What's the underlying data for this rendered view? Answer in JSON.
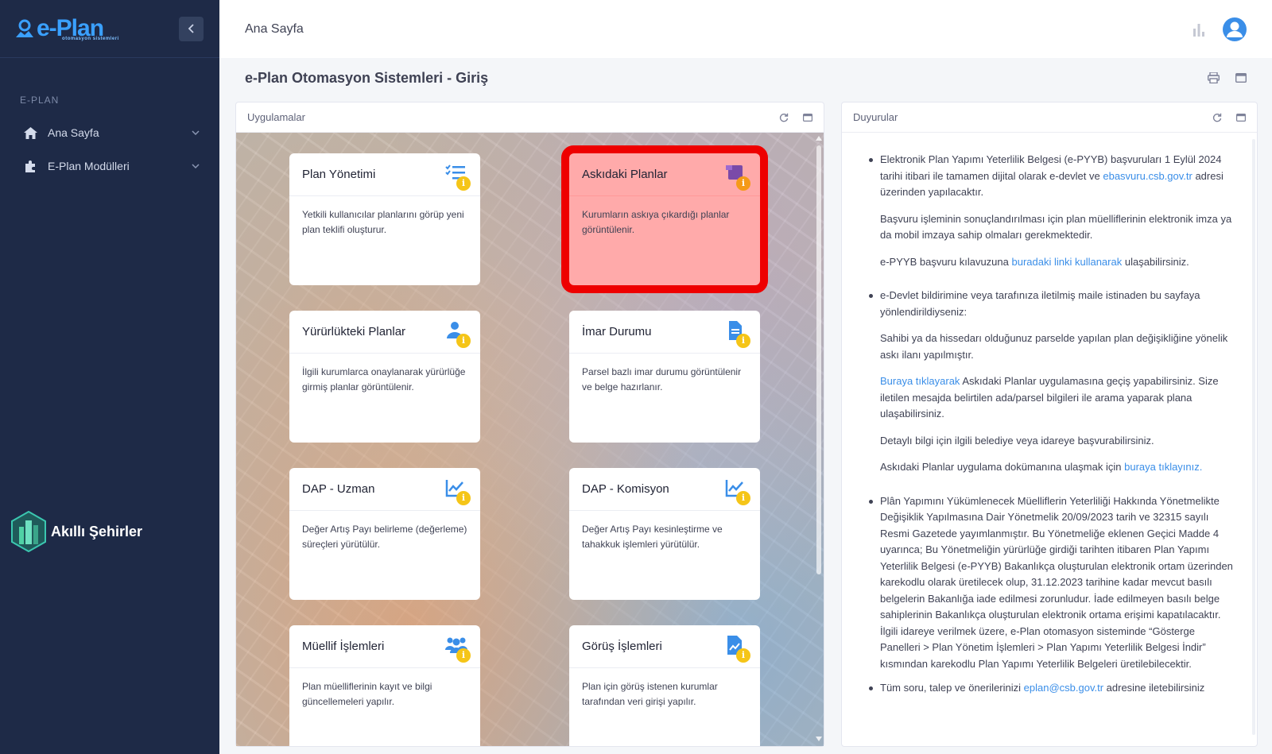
{
  "sidebar": {
    "logo_text": "e-Plan",
    "logo_subtext": "otomasyon sistemleri",
    "section_label": "E-PLAN",
    "items": [
      {
        "label": "Ana Sayfa"
      },
      {
        "label": "E-Plan Modülleri"
      }
    ],
    "brand_text": "Akıllı Şehirler"
  },
  "header": {
    "title": "Ana Sayfa"
  },
  "page": {
    "title": "e-Plan Otomasyon Sistemleri - Giriş"
  },
  "apps_panel": {
    "title": "Uygulamalar",
    "tiles": [
      {
        "title": "Plan Yönetimi",
        "desc": "Yetkili kullanıcılar planlarını görüp yeni plan teklifi oluşturur.",
        "icon": "list-check-icon",
        "info": "i"
      },
      {
        "title": "Askıdaki Planlar",
        "desc": "Kurumların askıya çıkardığı planlar görüntülenir.",
        "icon": "bookmark-icon",
        "info": "i",
        "highlighted": true
      },
      {
        "title": "Yürürlükteki Planlar",
        "desc": "İlgili kurumlarca onaylanarak yürürlüğe girmiş planlar görüntülenir.",
        "icon": "user-icon",
        "info": "i"
      },
      {
        "title": "İmar Durumu",
        "desc": "Parsel bazlı imar durumu görüntülenir ve belge hazırlanır.",
        "icon": "document-icon",
        "info": "i"
      },
      {
        "title": "DAP - Uzman",
        "desc": "Değer Artış Payı belirleme (değerleme) süreçleri yürütülür.",
        "icon": "chart-line-icon",
        "info": "i"
      },
      {
        "title": "DAP - Komisyon",
        "desc": "Değer Artış Payı kesinleştirme ve tahakkuk işlemleri yürütülür.",
        "icon": "chart-line-icon",
        "info": "i"
      },
      {
        "title": "Müellif İşlemleri",
        "desc": "Plan müelliflerinin kayıt ve bilgi güncellemeleri yapılır.",
        "icon": "users-icon",
        "info": "i"
      },
      {
        "title": "Görüş İşlemleri",
        "desc": "Plan için görüş istenen kurumlar tarafından veri girişi yapılır.",
        "icon": "file-chart-icon",
        "info": "i"
      }
    ]
  },
  "ann_panel": {
    "title": "Duyurular",
    "a1_p1_pre": "Elektronik Plan Yapımı Yeterlilik Belgesi (e-PYYB) başvuruları 1 Eylül 2024 tarihi itibari ile tamamen dijital olarak e-devlet ve ",
    "a1_p1_link": "ebasvuru.csb.gov.tr",
    "a1_p1_post": " adresi üzerinden yapılacaktır.",
    "a1_p2": "Başvuru işleminin sonuçlandırılması için plan müelliflerinin elektronik imza ya da mobil imzaya sahip olmaları gerekmektedir.",
    "a1_p3_pre": "e-PYYB başvuru kılavuzuna ",
    "a1_p3_link": "buradaki linki kullanarak",
    "a1_p3_post": " ulaşabilirsiniz.",
    "a2_p1": "e-Devlet bildirimine veya tarafınıza iletilmiş maile istinaden bu sayfaya yönlendirildiyseniz:",
    "a2_p2": "Sahibi ya da hissedarı olduğunuz parselde yapılan plan değişikliğine yönelik askı ilanı yapılmıştır.",
    "a2_p3_link": "Buraya tıklayarak",
    "a2_p3_post": " Askıdaki Planlar uygulamasına geçiş yapabilirsiniz. Size iletilen mesajda belirtilen ada/parsel bilgileri ile arama yaparak plana ulaşabilirsiniz.",
    "a2_p4": "Detaylı bilgi için ilgili belediye veya idareye başvurabilirsiniz.",
    "a2_p5_pre": "Askıdaki Planlar uygulama dokümanına ulaşmak için ",
    "a2_p5_link": "buraya tıklayınız.",
    "a3_p1": "Plân Yapımını Yükümlenecek Müelliflerin Yeterliliği Hakkında Yönetmelikte Değişiklik Yapılmasına Dair Yönetmelik 20/09/2023 tarih ve 32315 sayılı Resmi Gazetede yayımlanmıştır. Bu Yönetmeliğe eklenen Geçici Madde 4 uyarınca; Bu Yönetmeliğin yürürlüğe girdiği tarihten itibaren Plan Yapımı Yeterlilik Belgesi (e-PYYB) Bakanlıkça oluşturulan elektronik ortam üzerinden karekodlu olarak üretilecek olup, 31.12.2023 tarihine kadar mevcut basılı belgelerin Bakanlığa iade edilmesi zorunludur. İade edilmeyen basılı belge sahiplerinin Bakanlıkça oluşturulan elektronik ortama erişimi kapatılacaktır. İlgili idareye verilmek üzere, e-Plan otomasyon sisteminde “Gösterge Panelleri > Plan Yönetim İşlemleri > Plan Yapımı Yeterlilik Belgesi İndir” kısmından karekodlu Plan Yapımı Yeterlilik Belgeleri üretilebilecektir.",
    "a4_p1_pre": "Tüm soru, talep ve önerilerinizi ",
    "a4_p1_link": "eplan@csb.gov.tr",
    "a4_p1_post": " adresine iletebilirsiniz"
  },
  "colors": {
    "sidebar_bg": "#1e2a47",
    "accent": "#3a8ee8",
    "highlight_border": "#ee0000",
    "highlight_fill": "#ffaaaa",
    "info_badge": "#f5c518"
  }
}
